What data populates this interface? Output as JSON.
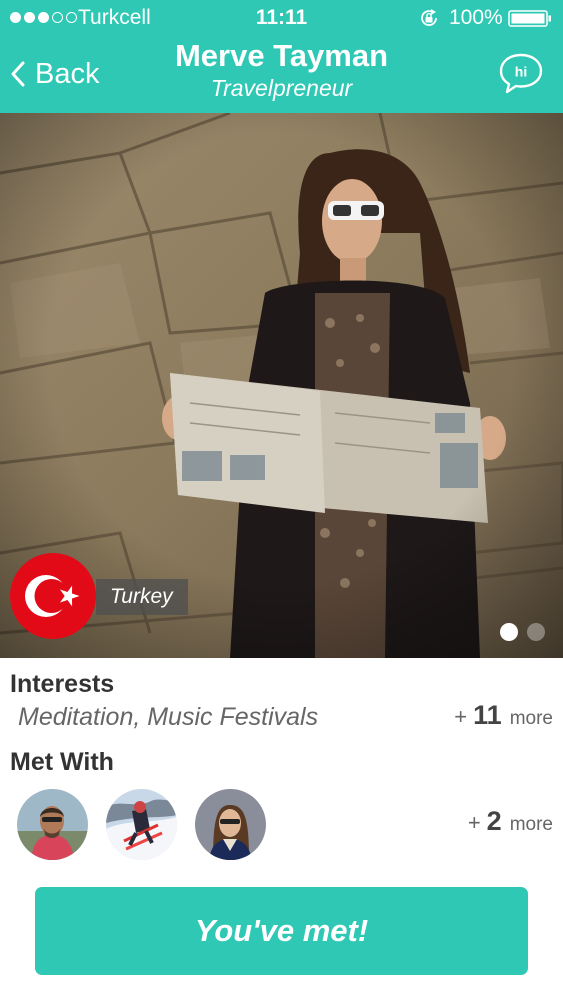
{
  "status_bar": {
    "signal_full": 3,
    "signal_empty": 2,
    "carrier": "Turkcell",
    "time": "11:11",
    "battery_percent": "100%",
    "icons": [
      "rotation-lock-icon",
      "battery-icon"
    ]
  },
  "nav": {
    "back_label": "Back",
    "name": "Merve Tayman",
    "subtitle": "Travelpreneur",
    "hi_label": "hi"
  },
  "photo": {
    "country": "Turkey",
    "flag": "turkey-flag-icon",
    "pages_total": 2,
    "page_active": 1
  },
  "interests": {
    "title": "Interests",
    "items": "Meditation, Music Festivals",
    "more_plus": "+",
    "more_count": "11",
    "more_label": "more"
  },
  "met_with": {
    "title": "Met With",
    "people": [
      "person-avatar-1",
      "person-avatar-2",
      "person-avatar-3"
    ],
    "more_plus": "+",
    "more_count": "2",
    "more_label": "more"
  },
  "action": {
    "label": "You've met!"
  },
  "colors": {
    "accent": "#2ec8b4",
    "flag_red": "#e30a17",
    "text_dark": "#333333",
    "text_muted": "#666666"
  }
}
